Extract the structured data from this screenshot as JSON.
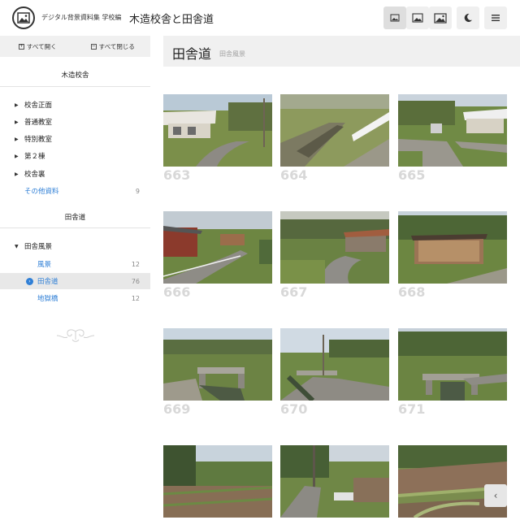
{
  "header": {
    "site_title": "デジタル背景資料集 学校編",
    "page_title": "木造校舎と田舎道",
    "icons": [
      "small-image-size-icon",
      "medium-image-size-icon",
      "large-image-size-icon",
      "moon-icon",
      "menu-icon"
    ]
  },
  "sidebar": {
    "expand_all": "すべて開く",
    "collapse_all": "すべて閉じる",
    "section1": {
      "title": "木造校舎",
      "items": [
        {
          "label": "校舎正面"
        },
        {
          "label": "普通教室"
        },
        {
          "label": "特別教室"
        },
        {
          "label": "第２棟"
        },
        {
          "label": "校舎裏"
        }
      ],
      "other": {
        "label": "その他資料",
        "count": "9"
      }
    },
    "section2": {
      "title": "田舎道",
      "parent": "田舎風景",
      "subitems": [
        {
          "label": "風景",
          "count": "12"
        },
        {
          "label": "田舎道",
          "count": "76"
        },
        {
          "label": "地獄橋",
          "count": "12"
        }
      ]
    }
  },
  "main": {
    "title": "田舎道",
    "subtitle": "田舎風景",
    "photos": [
      {
        "num": "663",
        "scene": "house-road"
      },
      {
        "num": "664",
        "scene": "ditch-guardrail"
      },
      {
        "num": "665",
        "scene": "house-fork"
      },
      {
        "num": "666",
        "scene": "shed-curve"
      },
      {
        "num": "667",
        "scene": "road-fields"
      },
      {
        "num": "668",
        "scene": "woodshed"
      },
      {
        "num": "669",
        "scene": "bridge"
      },
      {
        "num": "670",
        "scene": "bridge-road"
      },
      {
        "num": "671",
        "scene": "bridge-hills"
      },
      {
        "num": "",
        "scene": "fields-hill"
      },
      {
        "num": "",
        "scene": "pole-road"
      },
      {
        "num": "",
        "scene": "terraces"
      }
    ]
  },
  "colors": {
    "accent": "#2f7fd6",
    "panel": "#f0f0f0"
  }
}
